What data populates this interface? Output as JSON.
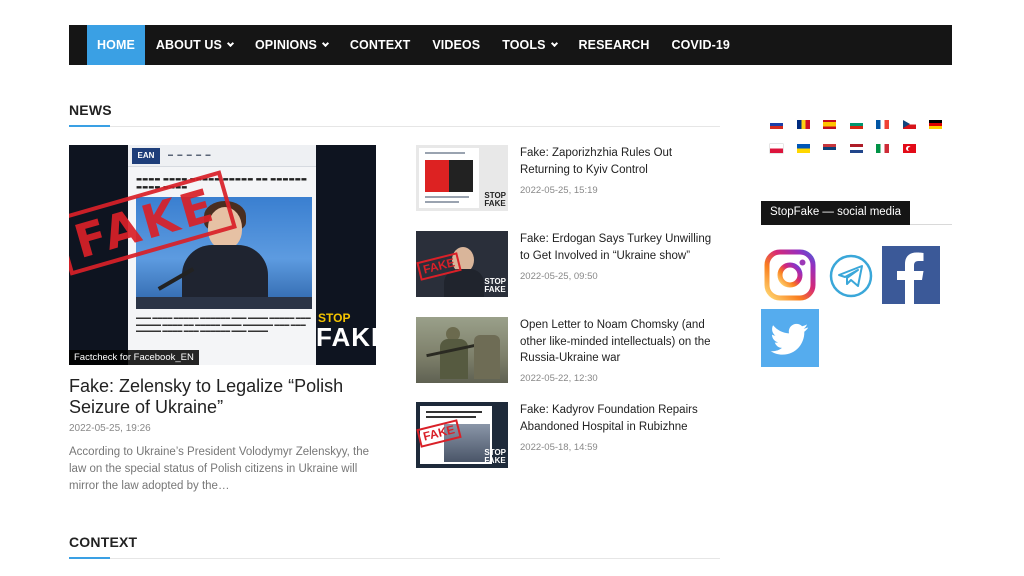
{
  "nav": {
    "items": [
      {
        "label": "HOME",
        "active": true,
        "dropdown": false
      },
      {
        "label": "ABOUT US",
        "active": false,
        "dropdown": true
      },
      {
        "label": "OPINIONS",
        "active": false,
        "dropdown": true
      },
      {
        "label": "CONTEXT",
        "active": false,
        "dropdown": false
      },
      {
        "label": "VIDEOS",
        "active": false,
        "dropdown": false
      },
      {
        "label": "TOOLS",
        "active": false,
        "dropdown": true
      },
      {
        "label": "RESEARCH",
        "active": false,
        "dropdown": false
      },
      {
        "label": "COVID-19",
        "active": false,
        "dropdown": false
      }
    ],
    "bg_color": "#151515",
    "active_color": "#3aa0e4"
  },
  "sections": {
    "news": "NEWS",
    "context": "CONTEXT"
  },
  "featured": {
    "image_label": "Factcheck for Facebook_EN",
    "title": "Fake:  Zelensky to Legalize “Polish Seizure of Ukraine”",
    "date": "2022-05-25, 19:26",
    "excerpt": "According to Ukraine’s President Volodymyr Zelenskyy, the law on the special status of Polish citizens in Ukraine will mirror the law adopted by the…"
  },
  "news_list": [
    {
      "title": "Fake: Zaporizhzhia Rules Out Returning to Kyiv Control",
      "date": "2022-05-25, 15:19"
    },
    {
      "title": "Fake: Erdogan Says Turkey Unwilling to Get Involved in “Ukraine show”",
      "date": "2022-05-25, 09:50"
    },
    {
      "title": "Open Letter to Noam Chomsky (and other like-minded intellectuals) on the Russia-Ukraine war",
      "date": "2022-05-22, 12:30"
    },
    {
      "title": "Fake: Kadyrov Foundation Repairs Abandoned Hospital in Rubizhne",
      "date": "2022-05-18, 14:59"
    }
  ],
  "flags": [
    "russia",
    "romania",
    "spain",
    "bulgaria",
    "france",
    "czech",
    "germany",
    "poland",
    "ukraine",
    "serbia",
    "netherlands",
    "italy",
    "turkey"
  ],
  "social": {
    "heading": "StopFake — social media",
    "icons": [
      "instagram-icon",
      "telegram-icon",
      "facebook-icon",
      "twitter-icon"
    ]
  }
}
